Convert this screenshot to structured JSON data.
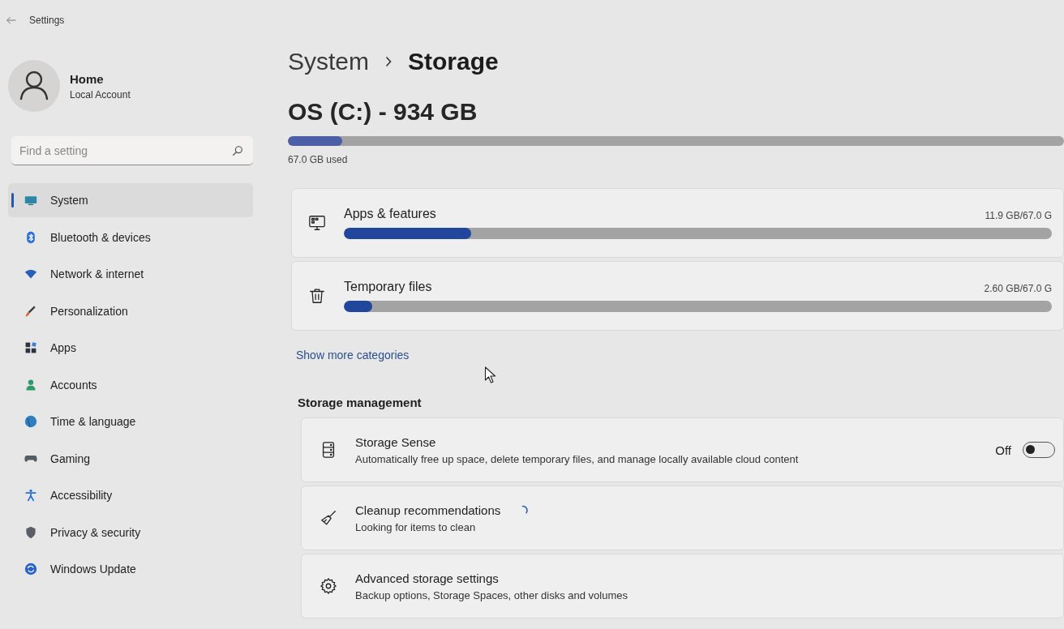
{
  "window": {
    "title": "Settings"
  },
  "profile": {
    "name": "Home",
    "account_type": "Local Account"
  },
  "search": {
    "placeholder": "Find a setting"
  },
  "sidebar": {
    "items": [
      {
        "label": "System",
        "selected": true
      },
      {
        "label": "Bluetooth & devices",
        "selected": false
      },
      {
        "label": "Network & internet",
        "selected": false
      },
      {
        "label": "Personalization",
        "selected": false
      },
      {
        "label": "Apps",
        "selected": false
      },
      {
        "label": "Accounts",
        "selected": false
      },
      {
        "label": "Time & language",
        "selected": false
      },
      {
        "label": "Gaming",
        "selected": false
      },
      {
        "label": "Accessibility",
        "selected": false
      },
      {
        "label": "Privacy & security",
        "selected": false
      },
      {
        "label": "Windows Update",
        "selected": false
      }
    ]
  },
  "breadcrumb": {
    "parent": "System",
    "current": "Storage"
  },
  "drive": {
    "title": "OS (C:) - 934 GB",
    "level": 0.07,
    "used": "67.0 GB used"
  },
  "categories": [
    {
      "name": "Apps & features",
      "size": "11.9 GB/67.0 G",
      "level": 0.18
    },
    {
      "name": "Temporary files",
      "size": "2.60 GB/67.0 G",
      "level": 0.04
    }
  ],
  "show_more_link": "Show more categories",
  "storage_management": {
    "heading": "Storage management",
    "items": [
      {
        "kind": "toggle",
        "title": "Storage Sense",
        "description": "Automatically free up space, delete temporary files, and manage locally available cloud content",
        "toggle": {
          "label": "Off",
          "on": false
        }
      },
      {
        "kind": "busy",
        "title": "Cleanup recommendations",
        "description": "Looking for items to clean",
        "loading": true
      },
      {
        "kind": "plain",
        "title": "Advanced storage settings",
        "description": "Backup options, Storage Spaces, other disks and volumes"
      }
    ]
  }
}
